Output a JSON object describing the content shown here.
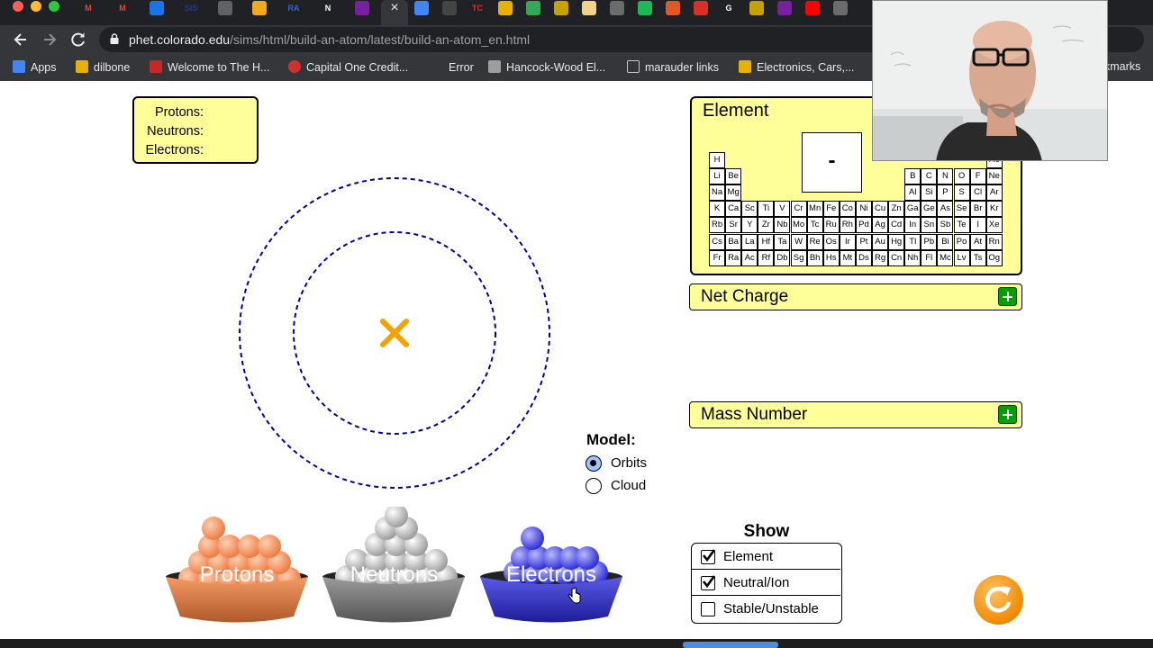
{
  "browser": {
    "tab_close": "×",
    "tab_favicons": [
      {
        "name": "gmail-icon",
        "text": "M",
        "color": "#ea4335"
      },
      {
        "name": "gmail-icon-2",
        "text": "M",
        "color": "#ea4335"
      },
      {
        "name": "contacts-icon",
        "text": "",
        "color": "#1a73e8"
      },
      {
        "name": "sis-icon",
        "text": "SIS",
        "color": "#1f3b8f"
      },
      {
        "name": "link-icon",
        "text": "",
        "color": "#5f6368"
      },
      {
        "name": "slides-icon",
        "text": "",
        "color": "#f4a81d"
      },
      {
        "name": "ra-icon",
        "text": "RA",
        "color": "#3366cc"
      },
      {
        "name": "n-icon",
        "text": "N",
        "color": "#ffffff"
      },
      {
        "name": "flag-icon",
        "text": "",
        "color": "#7b1fa2"
      }
    ],
    "right_favicons": [
      {
        "name": "docs-icon",
        "text": "",
        "color": "#4285f4"
      },
      {
        "name": "phet-icon",
        "text": "",
        "color": "#444444"
      },
      {
        "name": "tc-icon",
        "text": "TC",
        "color": "#d62f2f"
      },
      {
        "name": "books-icon",
        "text": "",
        "color": "#e8b100"
      },
      {
        "name": "drive-icon",
        "text": "",
        "color": "#34a853"
      },
      {
        "name": "bar-icon",
        "text": "",
        "color": "#c7a100"
      },
      {
        "name": "cup-icon",
        "text": "",
        "color": "#f1d28a"
      },
      {
        "name": "circle-icon",
        "text": "",
        "color": "#6b6b6b"
      },
      {
        "name": "spotify-icon",
        "text": "",
        "color": "#1db954"
      },
      {
        "name": "fire-icon",
        "text": "",
        "color": "#e25822"
      },
      {
        "name": "ring-icon",
        "text": "",
        "color": "#d93025"
      },
      {
        "name": "google-icon",
        "text": "G",
        "color": "#ffffff"
      },
      {
        "name": "bar-icon-2",
        "text": "",
        "color": "#c7a100"
      },
      {
        "name": "peace-icon",
        "text": "",
        "color": "#7b1fa2"
      },
      {
        "name": "youtube-icon",
        "text": "",
        "color": "#ff0000"
      },
      {
        "name": "gray-icon",
        "text": "",
        "color": "#6b6b6b"
      }
    ],
    "url_host": "phet.colorado.edu",
    "url_path": "/sims/html/build-an-atom/latest/build-an-atom_en.html",
    "bookmarks": [
      {
        "label": "Apps",
        "color": "#4285f4"
      },
      {
        "label": "dilbone",
        "color": "#e8b100"
      },
      {
        "label": "Welcome to The H...",
        "color": "#c62828"
      },
      {
        "label": "Capital One Credit...",
        "color": "#d32f2f"
      },
      {
        "label": "Error",
        "color": ""
      },
      {
        "label": "Hancock-Wood El...",
        "color": "#9e9e9e"
      },
      {
        "label": "marauder links",
        "color": "#c8c8c8"
      },
      {
        "label": "Electronics, Cars,...",
        "color": "#e8b100"
      }
    ],
    "bookmarks_overflow": "kmarks"
  },
  "counts": {
    "protons_label": "Protons:",
    "neutrons_label": "Neutrons:",
    "electrons_label": "Electrons:"
  },
  "model": {
    "title": "Model:",
    "options": [
      {
        "label": "Orbits",
        "selected": true
      },
      {
        "label": "Cloud",
        "selected": false
      }
    ]
  },
  "buckets": {
    "protons": "Protons",
    "neutrons": "Neutrons",
    "electrons": "Electrons"
  },
  "element_panel": {
    "title": "Element",
    "symbol": "-",
    "periodic_rows": [
      [
        "H",
        "",
        "",
        "",
        "",
        "",
        "",
        "",
        "",
        "",
        "",
        "",
        "",
        "",
        "",
        "",
        "",
        "He"
      ],
      [
        "Li",
        "Be",
        "",
        "",
        "",
        "",
        "",
        "",
        "",
        "",
        "",
        "",
        "B",
        "C",
        "N",
        "O",
        "F",
        "Ne"
      ],
      [
        "Na",
        "Mg",
        "",
        "",
        "",
        "",
        "",
        "",
        "",
        "",
        "",
        "",
        "Al",
        "Si",
        "P",
        "S",
        "Cl",
        "Ar"
      ],
      [
        "K",
        "Ca",
        "Sc",
        "Ti",
        "V",
        "Cr",
        "Mn",
        "Fe",
        "Co",
        "Ni",
        "Cu",
        "Zn",
        "Ga",
        "Ge",
        "As",
        "Se",
        "Br",
        "Kr"
      ],
      [
        "Rb",
        "Sr",
        "Y",
        "Zr",
        "Nb",
        "Mo",
        "Tc",
        "Ru",
        "Rh",
        "Pd",
        "Ag",
        "Cd",
        "In",
        "Sn",
        "Sb",
        "Te",
        "I",
        "Xe"
      ],
      [
        "Cs",
        "Ba",
        "La",
        "Hf",
        "Ta",
        "W",
        "Re",
        "Os",
        "Ir",
        "Pt",
        "Au",
        "Hg",
        "Tl",
        "Pb",
        "Bi",
        "Po",
        "At",
        "Rn"
      ],
      [
        "Fr",
        "Ra",
        "Ac",
        "Rf",
        "Db",
        "Sg",
        "Bh",
        "Hs",
        "Mt",
        "Ds",
        "Rg",
        "Cn",
        "Nh",
        "Fl",
        "Mc",
        "Lv",
        "Ts",
        "Og"
      ]
    ]
  },
  "net_charge": {
    "title": "Net Charge"
  },
  "mass_number": {
    "title": "Mass Number"
  },
  "show": {
    "title": "Show",
    "items": [
      {
        "label": "Element",
        "checked": true
      },
      {
        "label": "Neutral/Ion",
        "checked": true
      },
      {
        "label": "Stable/Unstable",
        "checked": false
      }
    ]
  },
  "colors": {
    "panel_yellow": "#ffff99",
    "proton": "#f28a55",
    "neutron": "#a6a6a6",
    "electron": "#3b3bd6",
    "orbit": "#0000a0",
    "nucleus_x": "#f5a200",
    "plus_green": "#00a000",
    "reset_orange": "#f08a00"
  }
}
